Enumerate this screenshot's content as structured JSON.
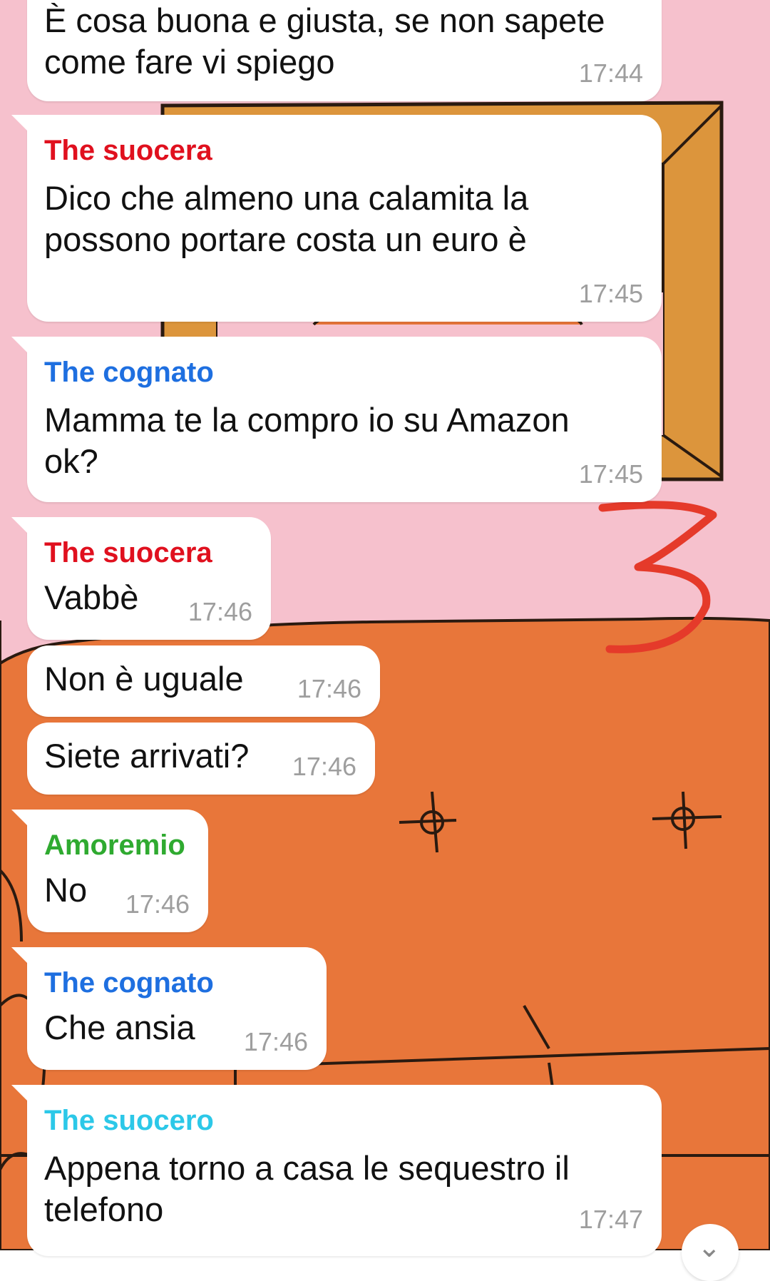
{
  "colors": {
    "wall": "#f6c1cd",
    "sofa": "#e8763a",
    "frame": "#dc953c",
    "sky": "#8fd3f0",
    "annotation": "#e53a2a",
    "name_suocera": "#e0101e",
    "name_cognato": "#1e6fe0",
    "name_amoremio": "#2faa30",
    "name_suocero": "#2cc8e8",
    "time": "#9e9e9e"
  },
  "annotation_text": "3",
  "messages": [
    {
      "sender": "",
      "text_lines": [
        "È cosa buona e giusta, se non sapete",
        "come fare vi spiego"
      ],
      "time": "17:44"
    },
    {
      "sender": "The suocera",
      "text_lines": [
        "Dico che almeno una calamita la",
        "possono portare costa un euro è"
      ],
      "time": "17:45"
    },
    {
      "sender": "The cognato",
      "text_lines": [
        "Mamma te la compro io su Amazon",
        "ok?"
      ],
      "time": "17:45"
    },
    {
      "sender": "The suocera",
      "text_lines": [
        "Vabbè"
      ],
      "time": "17:46"
    },
    {
      "sender": "",
      "text_lines": [
        "Non è uguale"
      ],
      "time": "17:46"
    },
    {
      "sender": "",
      "text_lines": [
        "Siete arrivati?"
      ],
      "time": "17:46"
    },
    {
      "sender": "Amoremio",
      "text_lines": [
        "No"
      ],
      "time": "17:46"
    },
    {
      "sender": "The cognato",
      "text_lines": [
        "Che ansia"
      ],
      "time": "17:46"
    },
    {
      "sender": "The suocero",
      "text_lines": [
        "Appena torno a casa le sequestro il",
        "telefono"
      ],
      "time": "17:47"
    }
  ],
  "scroll_icon": "chevron-down-icon"
}
